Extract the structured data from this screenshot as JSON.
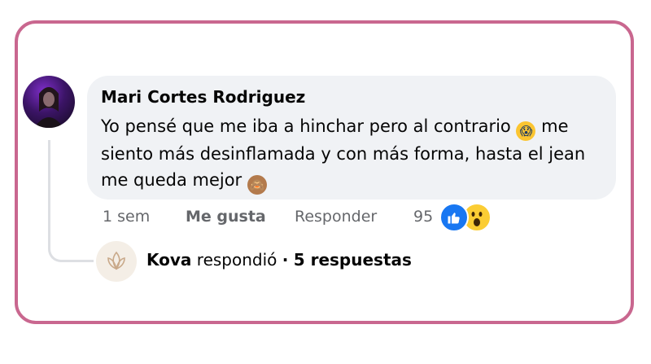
{
  "comment": {
    "author": "Mari Cortes Rodriguez",
    "text_line1": "Yo pensé que me iba a hinchar pero al contrario",
    "text_line1_end": "me",
    "text_line2": "siento más desinflamada y con más forma, hasta el jean",
    "text_line3": "me queda mejor",
    "emoji_1": "scream-emoji",
    "emoji_2": "see-no-evil-monkey-emoji"
  },
  "actions": {
    "time": "1 sem",
    "like_label": "Me gusta",
    "reply_label": "Responder",
    "reaction_count": "95",
    "reaction_icons": [
      "like-icon",
      "wow-icon"
    ]
  },
  "reply_summary": {
    "name": "Kova",
    "verb": "respondió",
    "separator": "·",
    "count_label": "5 respuestas"
  },
  "colors": {
    "frame_border": "#c9678f",
    "bubble_bg": "#f0f2f5",
    "meta_text": "#65676b",
    "like_blue": "#1877f2"
  }
}
